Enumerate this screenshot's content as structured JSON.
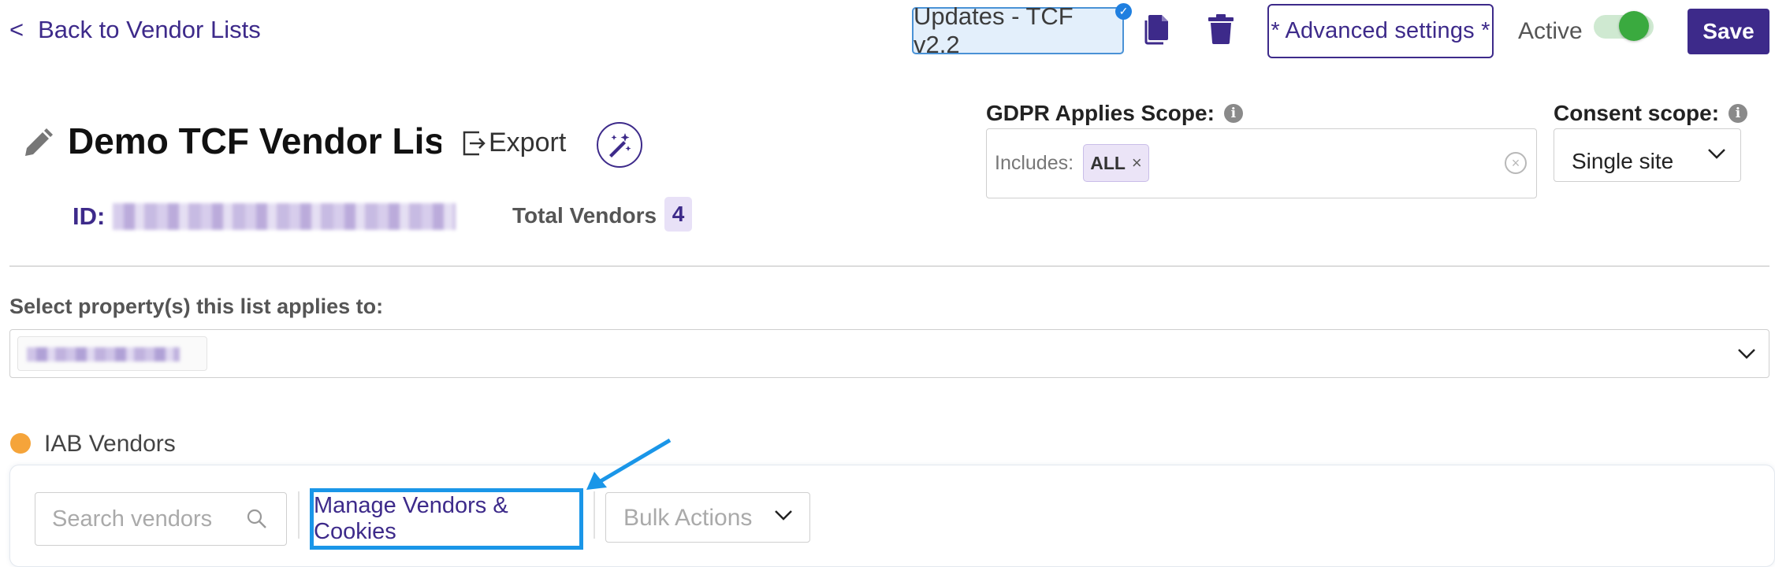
{
  "header": {
    "back_label": "Back to Vendor Lists",
    "back_chevron": "<",
    "updates_label": "Updates - TCF v2.2",
    "advanced_label": "* Advanced settings *",
    "active_label": "Active",
    "active_state": true,
    "save_label": "Save"
  },
  "title_row": {
    "title": "Demo TCF Vendor Lis",
    "export_label": "Export",
    "id_label": "ID:",
    "total_vendors_label": "Total Vendors",
    "total_vendors_count": "4"
  },
  "gdpr_scope": {
    "label": "GDPR Applies Scope:",
    "includes_label": "Includes:",
    "tag": "ALL",
    "tag_remove": "×"
  },
  "consent_scope": {
    "label": "Consent scope:",
    "value": "Single site"
  },
  "property_select": {
    "label": "Select property(s) this list applies to:"
  },
  "iab_section": {
    "label": "IAB Vendors",
    "search_placeholder": "Search vendors",
    "manage_label": "Manage Vendors & Cookies",
    "bulk_label": "Bulk Actions"
  },
  "colors": {
    "brand": "#3d2a8a",
    "toggle_on": "#3aaa3f",
    "status_dot": "#f5a43a",
    "annotation": "#1a96e8"
  }
}
